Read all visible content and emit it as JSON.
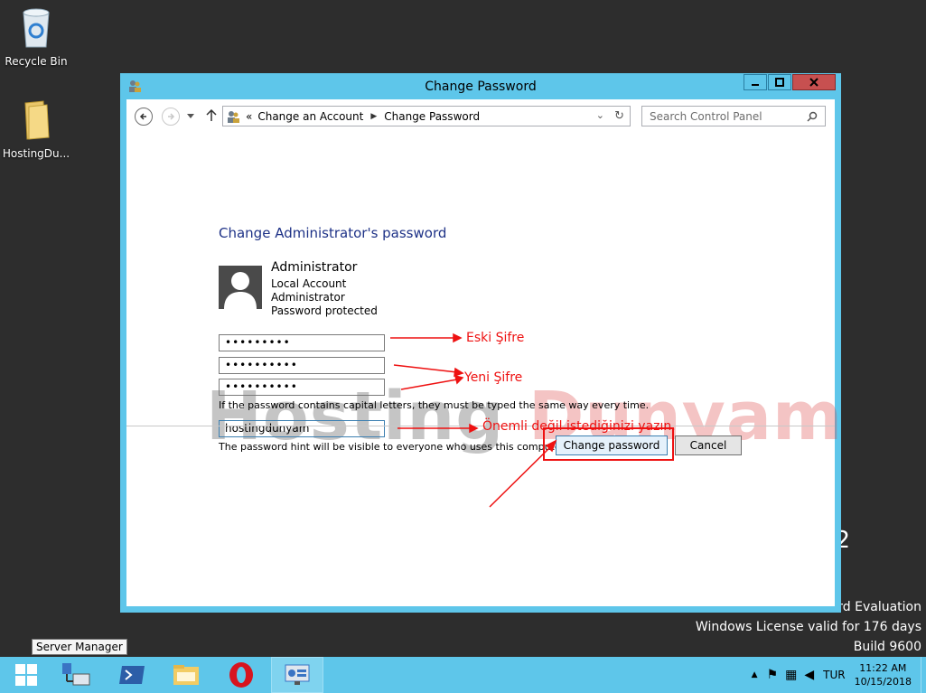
{
  "desktop": {
    "icons": [
      {
        "label": "Recycle Bin"
      },
      {
        "label": "HostingDu..."
      }
    ],
    "watermark_line1": "rd Evaluation",
    "watermark_line2": "Windows License valid for 176 days",
    "watermark_line3": "Build 9600",
    "watermark_fragment": "2"
  },
  "window": {
    "title": "Change Password",
    "breadcrumb_prefix": "«",
    "breadcrumb": [
      "Change an Account",
      "Change Password"
    ],
    "search_placeholder": "Search Control Panel"
  },
  "content": {
    "heading": "Change Administrator's password",
    "account_name": "Administrator",
    "account_lines": [
      "Local Account",
      "Administrator",
      "Password protected"
    ],
    "current_password": "•••••••••",
    "new_password": "••••••••••",
    "confirm_password": "••••••••••",
    "caps_note": "If the password contains capital letters, they must be typed the same way every time.",
    "hint_value": "hostingdunyam",
    "hint_note": "The password hint will be visible to everyone who uses this computer.",
    "change_button": "Change password",
    "cancel_button": "Cancel"
  },
  "annotations": {
    "old_password": "Eski Şifre",
    "new_password": "Yeni Şifre",
    "hint": "Önemli değil istediğinizi yazın.",
    "color": "#e11111"
  },
  "watermark": {
    "part1": "Hosting",
    "part2": "Dunyam"
  },
  "taskbar": {
    "tooltip": "Server Manager",
    "language": "TUR",
    "time": "11:22 AM",
    "date": "10/15/2018"
  },
  "colors": {
    "accent": "#5ec6ea",
    "desktop": "#2d2d2d",
    "heading": "#1e3287"
  }
}
